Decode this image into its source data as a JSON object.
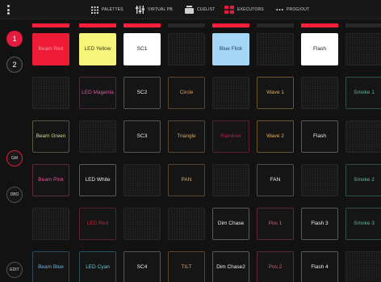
{
  "topbar": {
    "tabs": [
      {
        "id": "palettes",
        "label": "PALETTES",
        "icon": "grid-icon"
      },
      {
        "id": "virtualpb",
        "label": "VIRTUAL PB",
        "icon": "sliders-icon"
      },
      {
        "id": "cuelist",
        "label": "CUELIST",
        "icon": "stack-icon"
      },
      {
        "id": "executors",
        "label": "EXECUTORS",
        "icon": "executor-grid-icon",
        "active_color": "#e31b3d"
      },
      {
        "id": "progout",
        "label": "PROG/OUT",
        "icon": "ellipsis-icon"
      }
    ]
  },
  "rail": {
    "page_1": "1",
    "page_2": "2",
    "gm": "GM",
    "dbo": "DBO",
    "edit": "EDIT"
  },
  "accent_color": "#e31b3d",
  "strips": [
    true,
    true,
    true,
    false,
    true,
    false,
    true,
    false
  ],
  "grid": [
    [
      {
        "label": "Beam Red",
        "bg": "#ee1b36",
        "color": "#ff9aa8",
        "border": "#ee1b36"
      },
      {
        "label": "LED Yellow",
        "bg": "#f4f57a",
        "color": "#3a3a1a",
        "border": "#f4f57a"
      },
      {
        "label": "SC1",
        "bg": "#ffffff",
        "color": "#222222",
        "border": "#ffffff"
      },
      null,
      {
        "label": "Blue Flick",
        "bg": "#a6d6f5",
        "color": "#1d3a55",
        "border": "#a6d6f5"
      },
      null,
      {
        "label": "Flash",
        "bg": "#ffffff",
        "color": "#222222",
        "border": "#ffffff"
      },
      null
    ],
    [
      null,
      {
        "label": "LED Magenta",
        "bg": "#151515",
        "color": "#d25aa0",
        "border": "#4a2a3f"
      },
      {
        "label": "SC2",
        "bg": "#151515",
        "color": "#eeeeee",
        "border": "#555555"
      },
      {
        "label": "Circle",
        "bg": "#151515",
        "color": "#d9a35a",
        "border": "#5a4630"
      },
      null,
      {
        "label": "Wave 1",
        "bg": "#151515",
        "color": "#e2b25a",
        "border": "#6a5530"
      },
      null,
      {
        "label": "Smoke 1",
        "bg": "#151515",
        "color": "#5fb9a2",
        "border": "#2f5148"
      }
    ],
    [
      {
        "label": "Beam Green",
        "bg": "#151515",
        "color": "#d6d68e",
        "border": "#565640"
      },
      null,
      {
        "label": "SC3",
        "bg": "#151515",
        "color": "#eeeeee",
        "border": "#555555"
      },
      {
        "label": "Triangle",
        "bg": "#151515",
        "color": "#d9a35a",
        "border": "#5a4630"
      },
      {
        "label": "Rainbow",
        "bg": "#151515",
        "color": "#b2234a",
        "border": "#5b1f30"
      },
      {
        "label": "Wave 2",
        "bg": "#151515",
        "color": "#e2b25a",
        "border": "#6a5530"
      },
      {
        "label": "Flash",
        "bg": "#151515",
        "color": "#eeeeee",
        "border": "#5a5a5a"
      },
      null
    ],
    [
      {
        "label": "Beam Pink",
        "bg": "#151515",
        "color": "#e1558e",
        "border": "#5a2c40"
      },
      {
        "label": "LED White",
        "bg": "#151515",
        "color": "#eeeeee",
        "border": "#5a5a5a"
      },
      null,
      {
        "label": "PAN",
        "bg": "#151515",
        "color": "#d9a35a",
        "border": "#5a4630"
      },
      null,
      {
        "label": "FAN",
        "bg": "#151515",
        "color": "#eeeeee",
        "border": "#4f4f4f"
      },
      null,
      {
        "label": "Smoke 2",
        "bg": "#151515",
        "color": "#5fb9a2",
        "border": "#2f5148"
      }
    ],
    [
      null,
      {
        "label": "LED Red",
        "bg": "#151515",
        "color": "#c9203f",
        "border": "#5b1f2c"
      },
      null,
      null,
      {
        "label": "Dim Chase",
        "bg": "#151515",
        "color": "#eeeeee",
        "border": "#5a5a5a"
      },
      {
        "label": "Pos 1",
        "bg": "#151515",
        "color": "#e45a74",
        "border": "#5b2a35"
      },
      {
        "label": "Flash 3",
        "bg": "#151515",
        "color": "#eeeeee",
        "border": "#5a5a5a"
      },
      {
        "label": "Smoke 3",
        "bg": "#151515",
        "color": "#5fb9a2",
        "border": "#2f5148"
      }
    ],
    [
      {
        "label": "Beam Blue",
        "bg": "#151515",
        "color": "#6fb1de",
        "border": "#2d4a5c"
      },
      {
        "label": "LED Cyan",
        "bg": "#151515",
        "color": "#62c9d6",
        "border": "#2b5258"
      },
      {
        "label": "SC4",
        "bg": "#151515",
        "color": "#eeeeee",
        "border": "#555555"
      },
      {
        "label": "TILT",
        "bg": "#151515",
        "color": "#d9a35a",
        "border": "#5a4630"
      },
      {
        "label": "Dim Chase2",
        "bg": "#151515",
        "color": "#eeeeee",
        "border": "#5a5a5a"
      },
      {
        "label": "Pos 2",
        "bg": "#151515",
        "color": "#e45a74",
        "border": "#5b2a35"
      },
      {
        "label": "Flash 4",
        "bg": "#151515",
        "color": "#eeeeee",
        "border": "#5a5a5a"
      },
      null
    ]
  ]
}
